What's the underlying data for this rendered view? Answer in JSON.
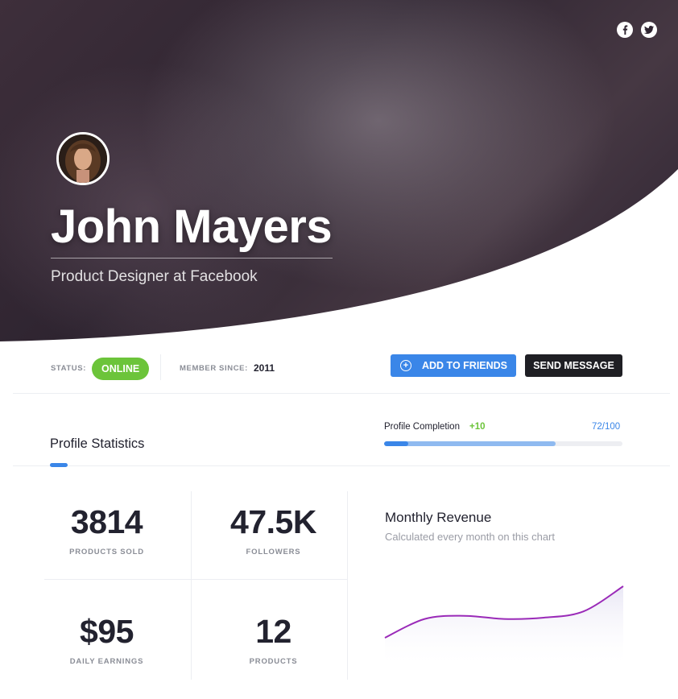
{
  "profile": {
    "name": "John Mayers",
    "title": "Product Designer at Facebook"
  },
  "social": {
    "icons": [
      "facebook-icon",
      "twitter-icon"
    ]
  },
  "status_bar": {
    "status_label": "STATUS:",
    "status_value": "ONLINE",
    "member_label": "MEMBER SINCE:",
    "member_value": "2011",
    "add_friends_label": "ADD TO FRIENDS",
    "send_message_label": "SEND MESSAGE"
  },
  "stats_header": {
    "title": "Profile Statistics",
    "completion_label": "Profile Completion",
    "completion_delta": "+10",
    "completion_value": "72/100",
    "completion_fraction": 0.72,
    "delta_fraction": 0.1
  },
  "stats": [
    {
      "value": "3814",
      "label": "PRODUCTS SOLD"
    },
    {
      "value": "47.5K",
      "label": "FOLLOWERS"
    },
    {
      "value": "$95",
      "label": "DAILY EARNINGS"
    },
    {
      "value": "12",
      "label": "PRODUCTS"
    }
  ],
  "revenue": {
    "title": "Monthly Revenue",
    "subtitle": "Calculated every month on this chart"
  },
  "chart_data": {
    "type": "area",
    "title": "Monthly Revenue",
    "subtitle": "Calculated every month on this chart",
    "x": [
      0,
      1,
      2,
      3,
      4,
      5,
      6
    ],
    "series": [
      {
        "values": [
          18,
          48,
          53,
          48,
          50,
          60,
          100
        ]
      }
    ],
    "ylim": [
      0,
      100
    ],
    "grid": false,
    "line_color": "#9a2ab8"
  },
  "colors": {
    "accent": "#3a86e8",
    "online": "#6cc43a",
    "dark_button": "#1f1f24"
  }
}
